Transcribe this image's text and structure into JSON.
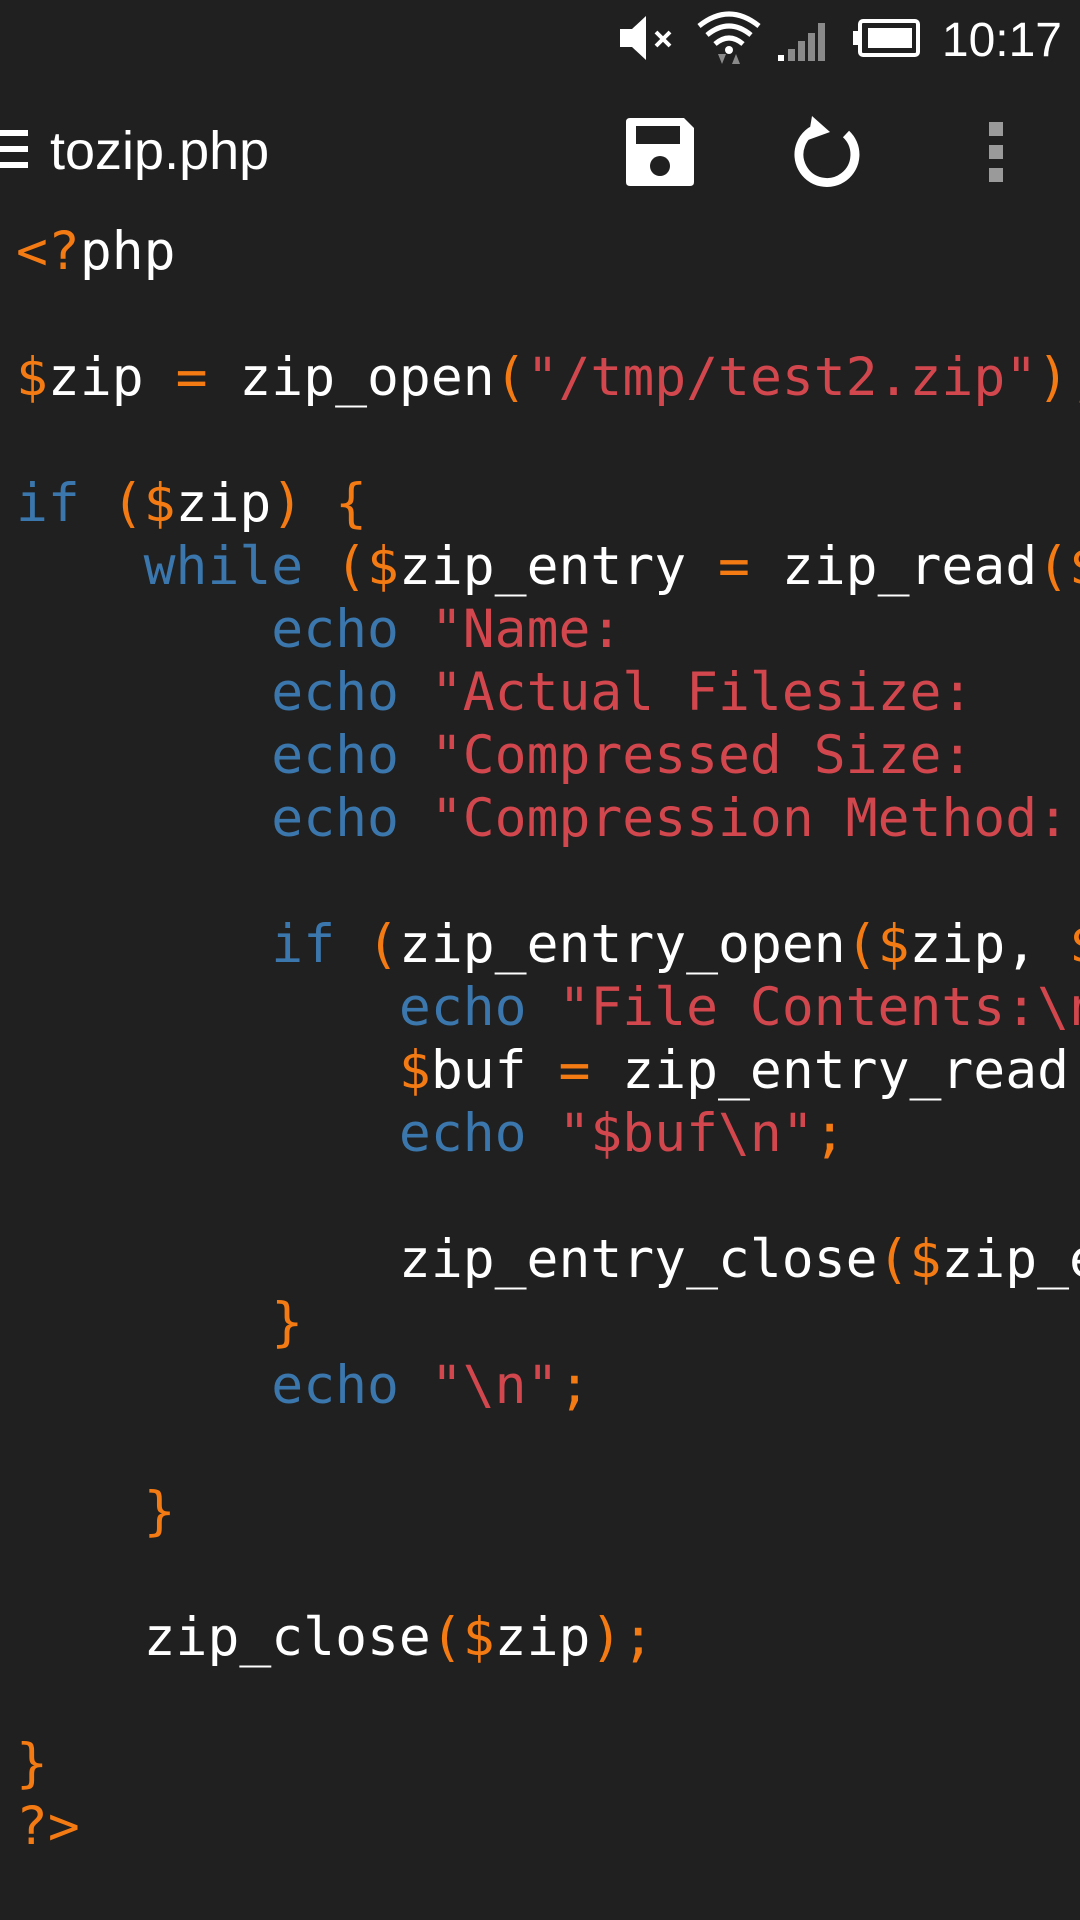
{
  "status_bar": {
    "time": "10:17",
    "icons": [
      "mute-icon",
      "wifi-icon",
      "signal-icon",
      "battery-icon"
    ]
  },
  "action_bar": {
    "title": "tozip.php",
    "menu_icon": "hamburger-icon",
    "actions": [
      "save-icon",
      "undo-icon",
      "overflow-icon"
    ]
  },
  "colors": {
    "background": "#202020",
    "keyword": "#3b77ad",
    "operator": "#f47a14",
    "string": "#d2474d",
    "text": "#ffffff"
  },
  "code": {
    "lines": [
      [
        {
          "t": "op",
          "s": "<?"
        },
        {
          "t": "plain",
          "s": "php"
        }
      ],
      [],
      [
        {
          "t": "op",
          "s": "$"
        },
        {
          "t": "plain",
          "s": "zip "
        },
        {
          "t": "op",
          "s": "="
        },
        {
          "t": "plain",
          "s": " zip_open"
        },
        {
          "t": "op",
          "s": "("
        },
        {
          "t": "str",
          "s": "\"/tmp/test2.zip\""
        },
        {
          "t": "op",
          "s": ");"
        }
      ],
      [],
      [
        {
          "t": "kw",
          "s": "if"
        },
        {
          "t": "plain",
          "s": " "
        },
        {
          "t": "op",
          "s": "($"
        },
        {
          "t": "plain",
          "s": "zip"
        },
        {
          "t": "op",
          "s": ")"
        },
        {
          "t": "plain",
          "s": " "
        },
        {
          "t": "op",
          "s": "{"
        }
      ],
      [
        {
          "t": "plain",
          "s": "    "
        },
        {
          "t": "kw",
          "s": "while"
        },
        {
          "t": "plain",
          "s": " "
        },
        {
          "t": "op",
          "s": "($"
        },
        {
          "t": "plain",
          "s": "zip_entry "
        },
        {
          "t": "op",
          "s": "="
        },
        {
          "t": "plain",
          "s": " zip_read"
        },
        {
          "t": "op",
          "s": "($"
        }
      ],
      [
        {
          "t": "plain",
          "s": "        "
        },
        {
          "t": "kw",
          "s": "echo"
        },
        {
          "t": "plain",
          "s": " "
        },
        {
          "t": "str",
          "s": "\"Name:"
        }
      ],
      [
        {
          "t": "plain",
          "s": "        "
        },
        {
          "t": "kw",
          "s": "echo"
        },
        {
          "t": "plain",
          "s": " "
        },
        {
          "t": "str",
          "s": "\"Actual Filesize:"
        }
      ],
      [
        {
          "t": "plain",
          "s": "        "
        },
        {
          "t": "kw",
          "s": "echo"
        },
        {
          "t": "plain",
          "s": " "
        },
        {
          "t": "str",
          "s": "\"Compressed Size:"
        }
      ],
      [
        {
          "t": "plain",
          "s": "        "
        },
        {
          "t": "kw",
          "s": "echo"
        },
        {
          "t": "plain",
          "s": " "
        },
        {
          "t": "str",
          "s": "\"Compression Method:"
        }
      ],
      [],
      [
        {
          "t": "plain",
          "s": "        "
        },
        {
          "t": "kw",
          "s": "if"
        },
        {
          "t": "plain",
          "s": " "
        },
        {
          "t": "op",
          "s": "("
        },
        {
          "t": "plain",
          "s": "zip_entry_open"
        },
        {
          "t": "op",
          "s": "($"
        },
        {
          "t": "plain",
          "s": "zip, "
        },
        {
          "t": "op",
          "s": "$"
        }
      ],
      [
        {
          "t": "plain",
          "s": "            "
        },
        {
          "t": "kw",
          "s": "echo"
        },
        {
          "t": "plain",
          "s": " "
        },
        {
          "t": "str",
          "s": "\"File Contents:\\n"
        }
      ],
      [
        {
          "t": "plain",
          "s": "            "
        },
        {
          "t": "op",
          "s": "$"
        },
        {
          "t": "plain",
          "s": "buf "
        },
        {
          "t": "op",
          "s": "="
        },
        {
          "t": "plain",
          "s": " zip_entry_read"
        }
      ],
      [
        {
          "t": "plain",
          "s": "            "
        },
        {
          "t": "kw",
          "s": "echo"
        },
        {
          "t": "plain",
          "s": " "
        },
        {
          "t": "str",
          "s": "\"$buf\\n\""
        },
        {
          "t": "op",
          "s": ";"
        }
      ],
      [],
      [
        {
          "t": "plain",
          "s": "            zip_entry_close"
        },
        {
          "t": "op",
          "s": "($"
        },
        {
          "t": "plain",
          "s": "zip_e"
        }
      ],
      [
        {
          "t": "plain",
          "s": "        "
        },
        {
          "t": "op",
          "s": "}"
        }
      ],
      [
        {
          "t": "plain",
          "s": "        "
        },
        {
          "t": "kw",
          "s": "echo"
        },
        {
          "t": "plain",
          "s": " "
        },
        {
          "t": "str",
          "s": "\"\\n\""
        },
        {
          "t": "op",
          "s": ";"
        }
      ],
      [],
      [
        {
          "t": "plain",
          "s": "    "
        },
        {
          "t": "op",
          "s": "}"
        }
      ],
      [],
      [
        {
          "t": "plain",
          "s": "    zip_close"
        },
        {
          "t": "op",
          "s": "($"
        },
        {
          "t": "plain",
          "s": "zip"
        },
        {
          "t": "op",
          "s": ");"
        }
      ],
      [],
      [
        {
          "t": "op",
          "s": "}"
        }
      ],
      [
        {
          "t": "op",
          "s": "?>"
        }
      ]
    ]
  }
}
